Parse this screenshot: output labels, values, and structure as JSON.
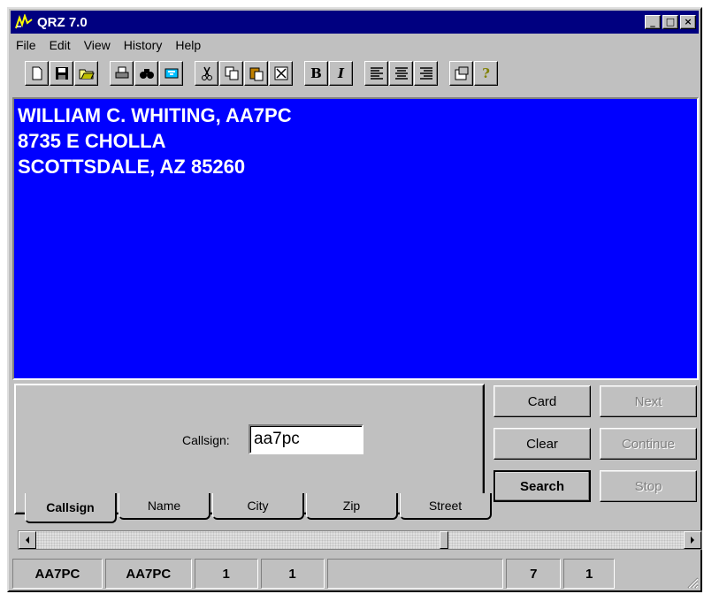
{
  "window": {
    "title": "QRZ 7.0"
  },
  "menu": {
    "items": [
      "File",
      "Edit",
      "View",
      "History",
      "Help"
    ]
  },
  "display": {
    "lines": [
      "WILLIAM C. WHITING, AA7PC",
      "8735 E CHOLLA",
      "SCOTTSDALE, AZ  85260"
    ]
  },
  "search": {
    "callsign_label": "Callsign:",
    "callsign_value": "aa7pc"
  },
  "tabs": [
    "Callsign",
    "Name",
    "City",
    "Zip",
    "Street"
  ],
  "buttons": {
    "card": "Card",
    "next": "Next",
    "clear": "Clear",
    "continue": "Continue",
    "search": "Search",
    "stop": "Stop"
  },
  "statusbar": [
    "AA7PC",
    "AA7PC",
    "1",
    "1",
    "",
    "7",
    "1"
  ],
  "colors": {
    "display_bg": "#0000ff",
    "titlebar": "#000080",
    "face": "#c0c0c0"
  }
}
